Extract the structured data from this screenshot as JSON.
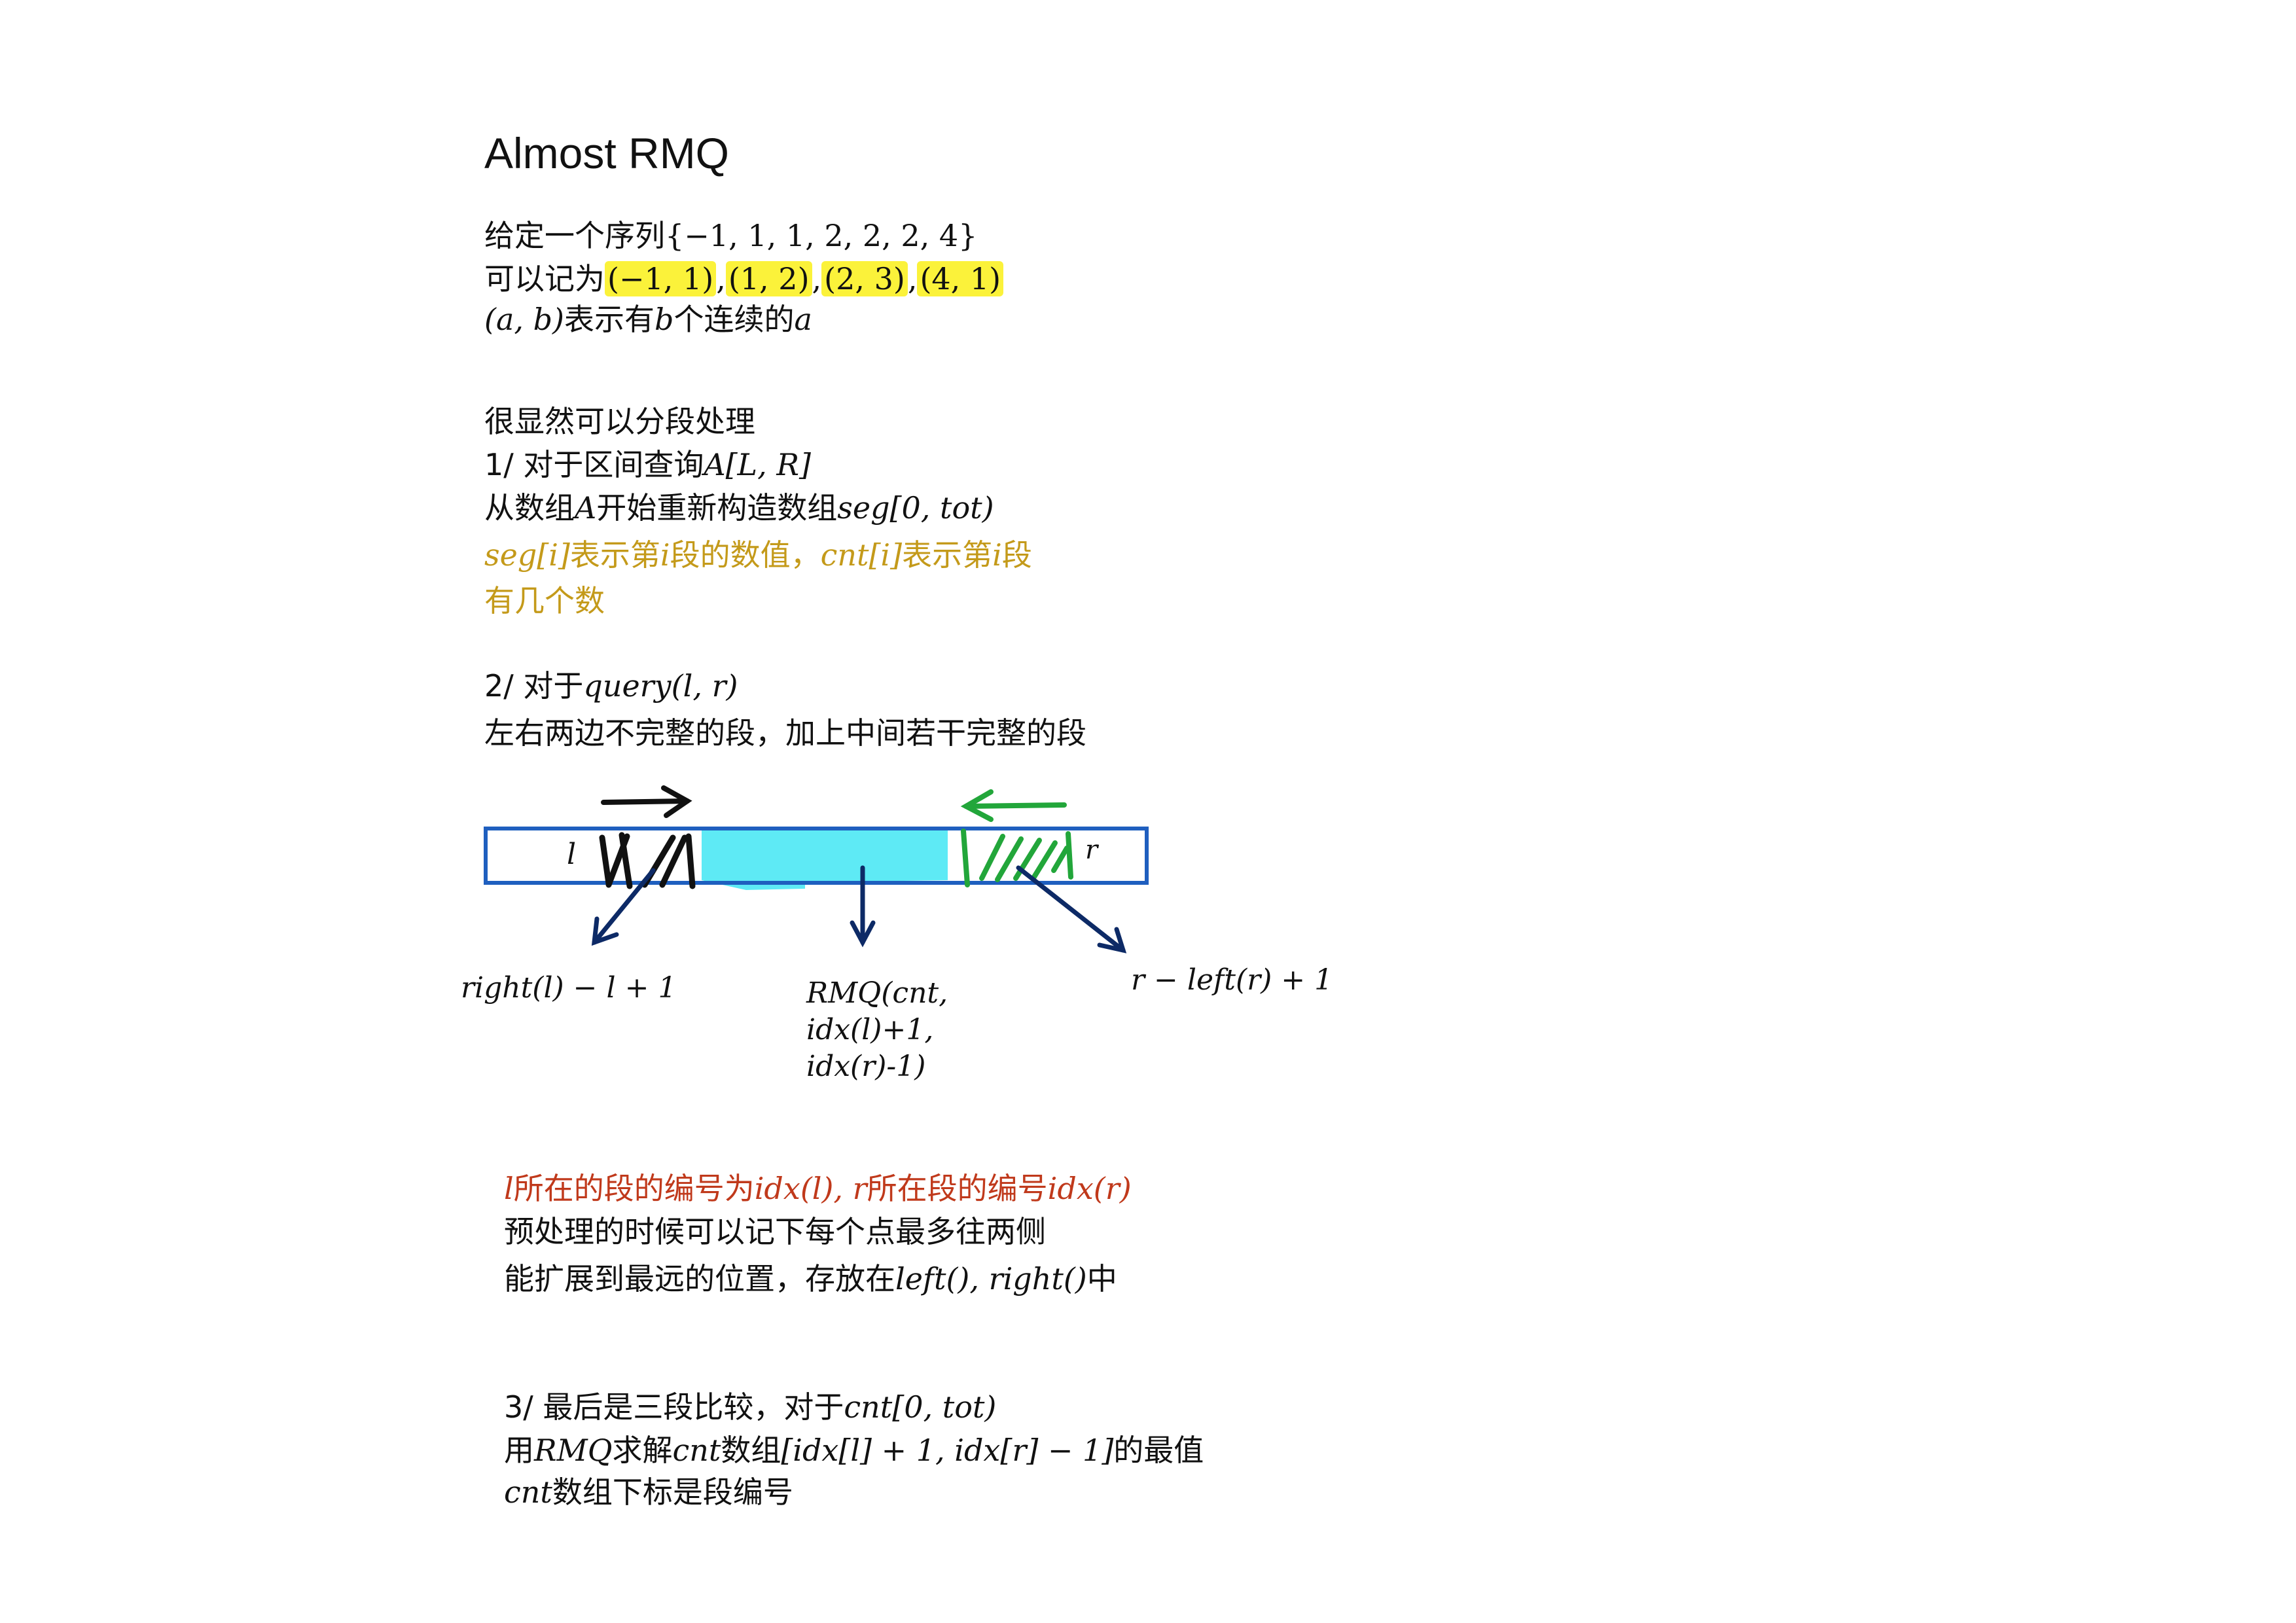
{
  "title": "Almost RMQ",
  "intro": {
    "line1_prefix": "给定一个序列",
    "line1_math": "{−1, 1, 1, 2, 2, 2, 4}",
    "line2_prefix": "可以记为",
    "pairs": [
      "(−1, 1)",
      "(1, 2)",
      "(2, 3)",
      "(4, 1)"
    ],
    "pair_sep": ",",
    "line3_math_a": "(a, b)",
    "line3_text_a": "表示有",
    "line3_math_b": "b",
    "line3_text_b": "个连续的",
    "line3_math_c": "a"
  },
  "section1": {
    "heading": "很显然可以分段处理",
    "step_prefix": "1/ 对于区间查询",
    "step_math": "A[L, R]",
    "build_prefix": "从数组",
    "build_math_a": "A",
    "build_text": "开始重新构造数组",
    "build_math_b": "seg[0, tot)",
    "gold_math_a": "seg[i]",
    "gold_text_a": "表示第",
    "gold_math_b": "i",
    "gold_text_b": "段的数值，",
    "gold_math_c": "cnt[i]",
    "gold_text_c": "表示第",
    "gold_math_d": "i",
    "gold_text_d": "段",
    "gold_line2": "有几个数"
  },
  "section2": {
    "step_prefix": "2/ 对于",
    "step_math": "query(l, r)",
    "desc": "左右两边不完整的段，加上中间若干完整的段"
  },
  "diagram": {
    "left_letter": "l",
    "right_letter": "r",
    "left_formula": "right(l) − l + 1",
    "mid_formula_lines": [
      "RMQ(cnt,",
      "idx(l)+1,",
      "idx(r)-1)"
    ],
    "right_formula": "r  − left(r) + 1",
    "colors": {
      "box": "#1f5fbf",
      "fill": "#5eeaf5",
      "green": "#22a63a",
      "arrow": "#0d2a66",
      "black": "#111111"
    }
  },
  "section_idx": {
    "red_math_a": "l",
    "red_text_a": "所在的段的编号为",
    "red_math_b": "idx(l), r",
    "red_text_b": "所在段的编号",
    "red_math_c": "idx(r)",
    "line2": "预处理的时候可以记下每个点最多往两侧",
    "line3_prefix": "能扩展到最远的位置，存放在",
    "line3_math": "left(), right()",
    "line3_suffix": "中"
  },
  "section3": {
    "step_prefix": "3/ 最后是三段比较，对于",
    "step_math": "cnt[0, tot)",
    "line2_text_a": "用",
    "line2_math_a": "RMQ",
    "line2_text_b": "求解",
    "line2_math_b": "cnt",
    "line2_text_c": "数组",
    "line2_math_c": "[idx[l] + 1, idx[r] − 1]",
    "line2_text_d": "的最值",
    "line3_math": "cnt",
    "line3_text": "数组下标是段编号"
  }
}
